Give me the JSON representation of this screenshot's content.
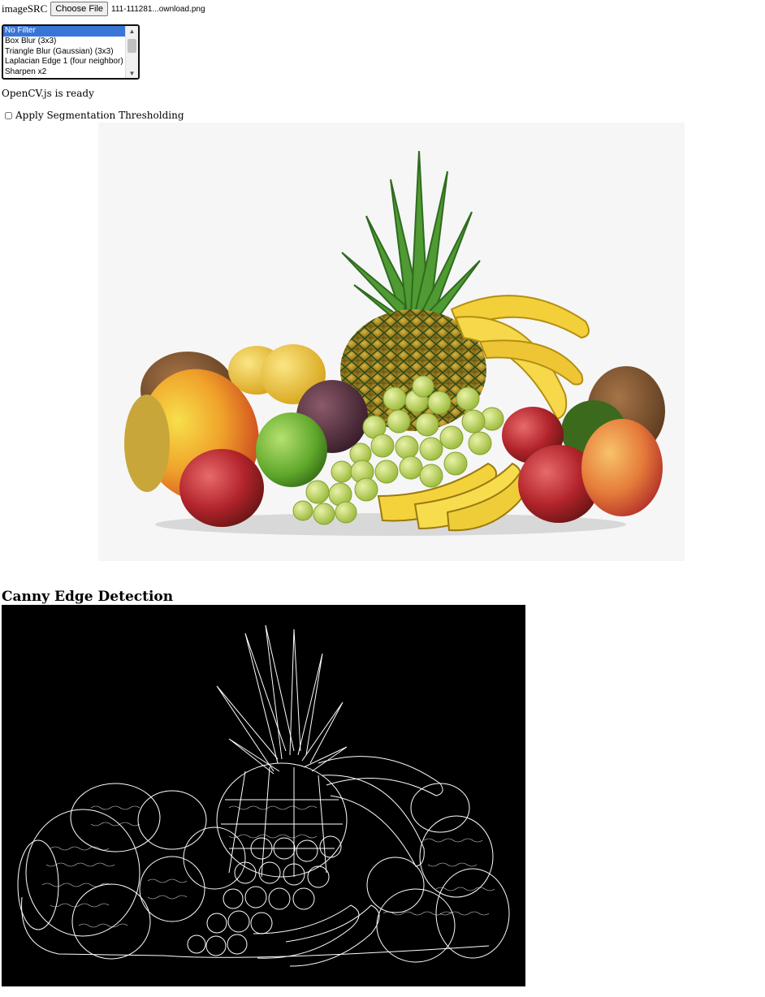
{
  "file_input": {
    "label": "imageSRC",
    "button_label": "Choose File",
    "file_name": "111-111281...ownload.png"
  },
  "filter_list": {
    "options": [
      "No Filter",
      "Box Blur (3x3)",
      "Triangle Blur (Gaussian) (3x3)",
      "Laplacian Edge 1 (four neighbor)",
      "Sharpen x2"
    ],
    "selected_index": 0
  },
  "status_text": "OpenCV.js is ready",
  "segmentation": {
    "label": "Apply Segmentation Thresholding",
    "checked": false
  },
  "canny": {
    "heading": "Canny Edge Detection"
  },
  "colors": {
    "selected_option": "#3875d7",
    "canny_background": "#000000",
    "image_background": "#f6f6f6"
  }
}
